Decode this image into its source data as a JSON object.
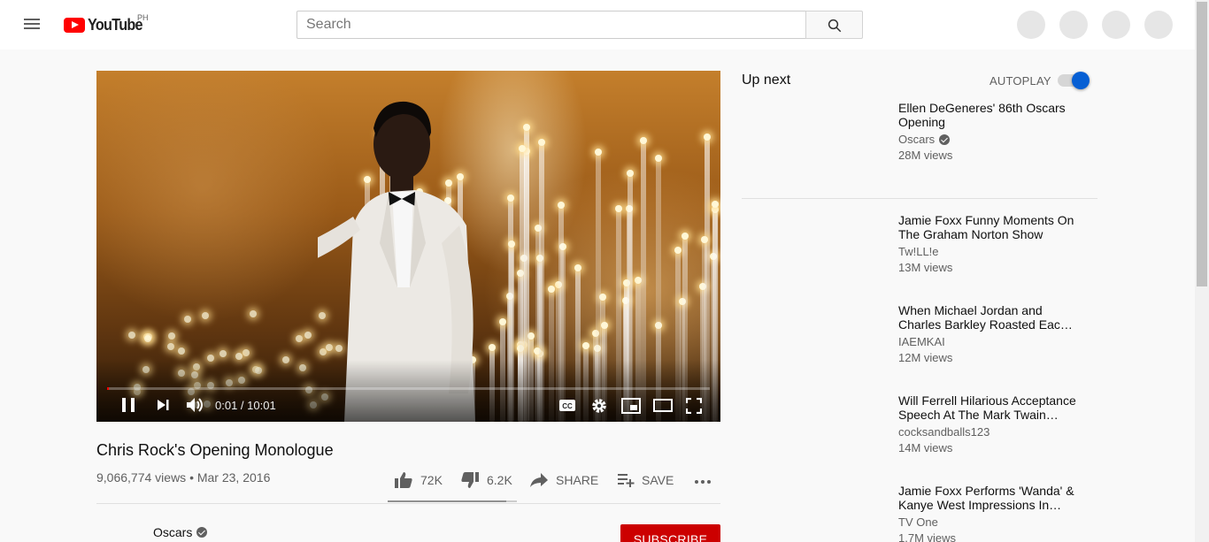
{
  "masthead": {
    "logo_text": "YouTube",
    "country_code": "PH",
    "search_placeholder": "Search"
  },
  "player": {
    "time_current": "0:01",
    "time_total": "10:01",
    "time_display": "0:01 / 10:01",
    "progress_fraction": 0.0017
  },
  "video": {
    "title": "Chris Rock's Opening Monologue",
    "views": "9,066,774 views",
    "date": "Mar 23, 2016",
    "meta": "9,066,774 views • Mar 23, 2016",
    "likes": "72K",
    "dislikes": "6.2K",
    "share_label": "SHARE",
    "save_label": "SAVE",
    "like_fraction": 0.92
  },
  "owner": {
    "channel": "Oscars",
    "subscribe_label": "SUBSCRIBE"
  },
  "sidebar": {
    "up_next_label": "Up next",
    "autoplay_label": "AUTOPLAY",
    "autoplay_on": true,
    "items": [
      {
        "title": "Ellen DeGeneres' 86th Oscars Opening",
        "channel": "Oscars",
        "verified": true,
        "views": "28M views"
      },
      {
        "title": "Jamie Foxx Funny Moments On The Graham Norton Show",
        "channel": "Tw!LL!e",
        "verified": false,
        "views": "13M views"
      },
      {
        "title": "When Michael Jordan and Charles Barkley Roasted Eac…",
        "channel": "IAEMKAI",
        "verified": false,
        "views": "12M views"
      },
      {
        "title": "Will Ferrell Hilarious Acceptance Speech At The Mark Twain…",
        "channel": "cocksandballs123",
        "verified": false,
        "views": "14M views"
      },
      {
        "title": "Jamie Foxx Performs 'Wanda' & Kanye West Impressions In…",
        "channel": "TV One",
        "verified": false,
        "views": "1.7M views"
      }
    ]
  },
  "colors": {
    "brand_red": "#ff0000",
    "subscribe_red": "#cc0000",
    "toggle_blue": "#065fd4",
    "progress_red": "#ff0000"
  },
  "icons": [
    "menu-icon",
    "youtube-logo-icon",
    "search-icon",
    "pause-icon",
    "next-icon",
    "volume-icon",
    "captions-icon",
    "settings-icon",
    "miniplayer-icon",
    "theater-icon",
    "fullscreen-icon",
    "thumbs-up-icon",
    "thumbs-down-icon",
    "share-icon",
    "playlist-add-icon",
    "more-icon",
    "verified-icon"
  ]
}
